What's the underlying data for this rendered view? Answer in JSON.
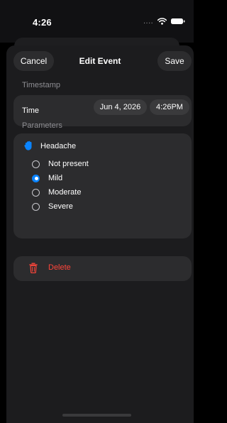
{
  "status_bar": {
    "time": "4:26",
    "signal": "....",
    "wifi_icon": "wifi-icon",
    "battery_icon": "battery-icon"
  },
  "nav": {
    "cancel_label": "Cancel",
    "title": "Edit Event",
    "save_label": "Save"
  },
  "timestamp_section": {
    "header": "Timestamp",
    "time_label": "Time",
    "date_value": "Jun 4, 2026",
    "time_value": "4:26PM"
  },
  "parameters_section": {
    "header": "Parameters",
    "parameter_name": "Headache",
    "parameter_icon": "hand-icon",
    "options": [
      {
        "label": "Not present",
        "selected": false
      },
      {
        "label": "Mild",
        "selected": true
      },
      {
        "label": "Moderate",
        "selected": false
      },
      {
        "label": "Severe",
        "selected": false
      }
    ]
  },
  "delete": {
    "label": "Delete",
    "icon": "trash-icon"
  },
  "colors": {
    "accent": "#0a84ff",
    "destructive": "#ff453a",
    "background": "#1c1c1e",
    "card": "#2c2c2e"
  }
}
